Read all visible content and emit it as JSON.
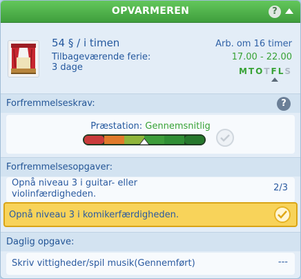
{
  "header": {
    "title": "OPVARMEREN",
    "help_label": "?"
  },
  "job": {
    "pay_amount": "54",
    "pay_currency": "§",
    "pay_unit": "/ i timen",
    "vacation_label": "Tilbageværende ferie:",
    "vacation_value": "3 dage",
    "work_in": "Arb. om 16 timer",
    "hours": "17.00 - 22.00",
    "days": [
      {
        "label": "M",
        "active": true
      },
      {
        "label": "T",
        "active": true
      },
      {
        "label": "O",
        "active": true
      },
      {
        "label": "T",
        "active": false
      },
      {
        "label": "F",
        "active": true
      },
      {
        "label": "L",
        "active": true
      },
      {
        "label": "S",
        "active": false
      }
    ]
  },
  "promotion": {
    "title": "Forfremmelseskrav:",
    "help_label": "?",
    "performance_label": "Præstation:",
    "performance_value": "Gennemsnitlig",
    "performance_level": 0.5
  },
  "promotion_tasks": {
    "title": "Forfremmelsesopgaver:",
    "tasks": [
      {
        "text_line1": "Opnå niveau 3 i guitar- eller",
        "text_line2": "violinfærdigheden.",
        "progress": "2/3"
      },
      {
        "text": "Opnå niveau 3 i komikerfærdigheden.",
        "completed": true
      }
    ]
  },
  "daily": {
    "title": "Daglig opgave:",
    "task": "Skriv vittigheder/spil musik(Gennemført)",
    "progress": "---"
  },
  "colors": {
    "header_green": "#4fb24a",
    "text_blue": "#24589e",
    "accent_green": "#37a235",
    "highlight_gold": "#f8d35a"
  }
}
